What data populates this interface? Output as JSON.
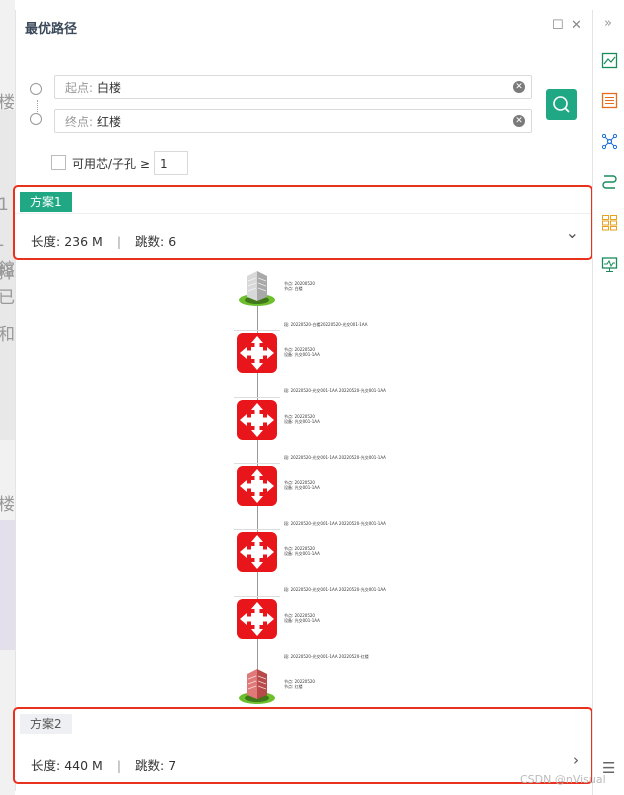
{
  "panel": {
    "title": "最优路径",
    "minimize_glyph": "☐",
    "close_glyph": "✕"
  },
  "route": {
    "start_label": "起点:",
    "start_value": "白楼",
    "end_label": "终点:",
    "end_value": "红楼",
    "clear_glyph": "✕",
    "filter_label": "可用芯/子孔 ≥",
    "filter_value": "1"
  },
  "plans": [
    {
      "name": "方案1",
      "length_label": "长度:",
      "length_value": "236 M",
      "sep": "|",
      "hops_label": "跳数:",
      "hops_value": "6",
      "chevron": "⌄"
    },
    {
      "name": "方案2",
      "length_label": "长度:",
      "length_value": "440 M",
      "sep": "|",
      "hops_label": "跳数:",
      "hops_value": "7",
      "chevron": "›"
    }
  ],
  "topology": {
    "nodes": [
      {
        "type": "building-white",
        "line1": "节点: 20200520",
        "line2": "节点: 白楼"
      },
      {
        "type": "switch",
        "line1": "节点: 20220520",
        "line2": "设备: 光交001-1AA"
      },
      {
        "type": "switch",
        "line1": "节点: 20220520",
        "line2": "设备: 光交001-1AA"
      },
      {
        "type": "switch",
        "line1": "节点: 20220520",
        "line2": "设备: 光交001-1AA"
      },
      {
        "type": "switch",
        "line1": "节点: 20220520",
        "line2": "设备: 光交001-1AA"
      },
      {
        "type": "switch",
        "line1": "节点: 20220520",
        "line2": "设备: 光交001-1AA"
      },
      {
        "type": "building-red",
        "line1": "节点: 20220520",
        "line2": "节点: 红楼"
      }
    ],
    "links": [
      "段: 20220520-白楼20220520-光交001-1AA",
      "段: 20220520-光交001-1AA 20220520-光交001-1AA",
      "段: 20220520-光交001-1AA 20220520-光交001-1AA",
      "段: 20220520-光交001-1AA 20220520-光交001-1AA",
      "段: 20220520-光交001-1AA 20220520-光交001-1AA",
      "段: 20220520-光交001-1AA 20220520-红楼"
    ]
  },
  "sidebar": {
    "expand_glyph": "»",
    "items": [
      "image-panel-icon",
      "list-panel-icon",
      "network-icon",
      "route-icon",
      "table-grid-icon",
      "monitor-icon"
    ],
    "menu_glyph": "☰"
  },
  "background_text": [
    "楼",
    "1",
    "-館",
    "择已",
    "和",
    "楼"
  ],
  "watermark": "CSDN @nVisual",
  "colors": {
    "accent": "#20a783",
    "highlight": "#e8321e",
    "switch": "#e8161a"
  }
}
